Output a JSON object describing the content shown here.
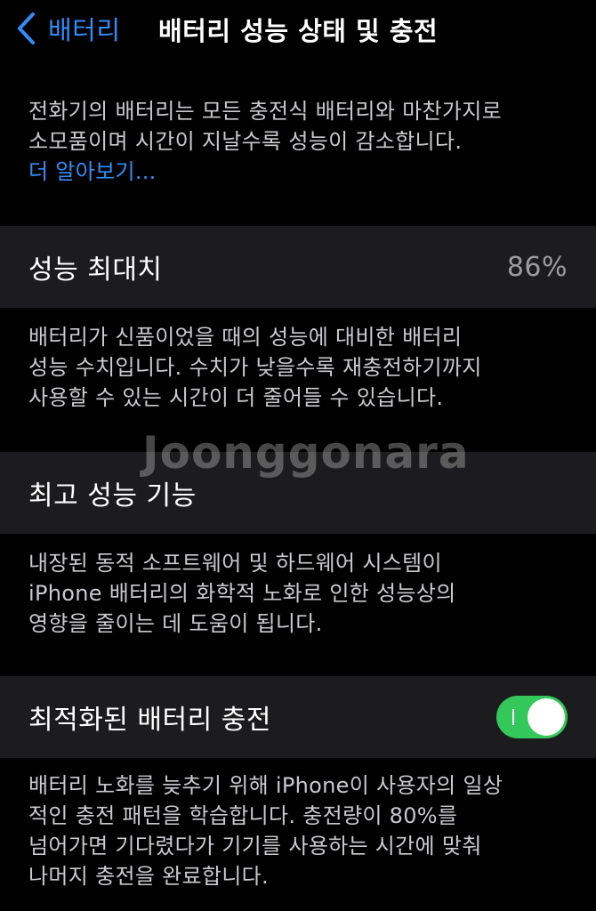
{
  "nav": {
    "back_label": "배터리",
    "title": "배터리 성능 상태 및 충전"
  },
  "intro": {
    "lines": [
      "전화기의 배터리는 모든 충전식 배터리와 마찬가지로",
      "소모품이며 시간이 지날수록 성능이 감소합니다."
    ],
    "learn_more": "더 알아보기..."
  },
  "max_capacity": {
    "label": "성능 최대치",
    "value": "86%",
    "footer_lines": [
      "배터리가 신품이었을 때의 성능에 대비한 배터리",
      "성능 수치입니다. 수치가 낮을수록 재충전하기까지",
      "사용할 수 있는 시간이 더 줄어들 수 있습니다."
    ]
  },
  "peak_performance": {
    "label": "최고 성능 기능",
    "footer_lines": [
      "내장된 동적 소프트웨어 및 하드웨어 시스템이",
      "iPhone 배터리의 화학적 노화로 인한 성능상의",
      "영향을 줄이는 데 도움이 됩니다."
    ]
  },
  "optimized_charging": {
    "label": "최적화된 배터리 충전",
    "enabled": true,
    "footer_lines": [
      "배터리 노화를 늦추기 위해 iPhone이 사용자의 일상",
      "적인 충전 패턴을 학습합니다. 충전량이 80%를",
      "넘어가면 기다렸다가 기기를 사용하는 시간에 맞춰",
      "나머지 충전을 완료합니다."
    ]
  },
  "watermark": "Joonggonara",
  "colors": {
    "accent": "#2f8ef7",
    "toggle_on": "#34c759",
    "cell_bg": "#1c1c1e",
    "secondary_text": "#9b9ba1"
  }
}
